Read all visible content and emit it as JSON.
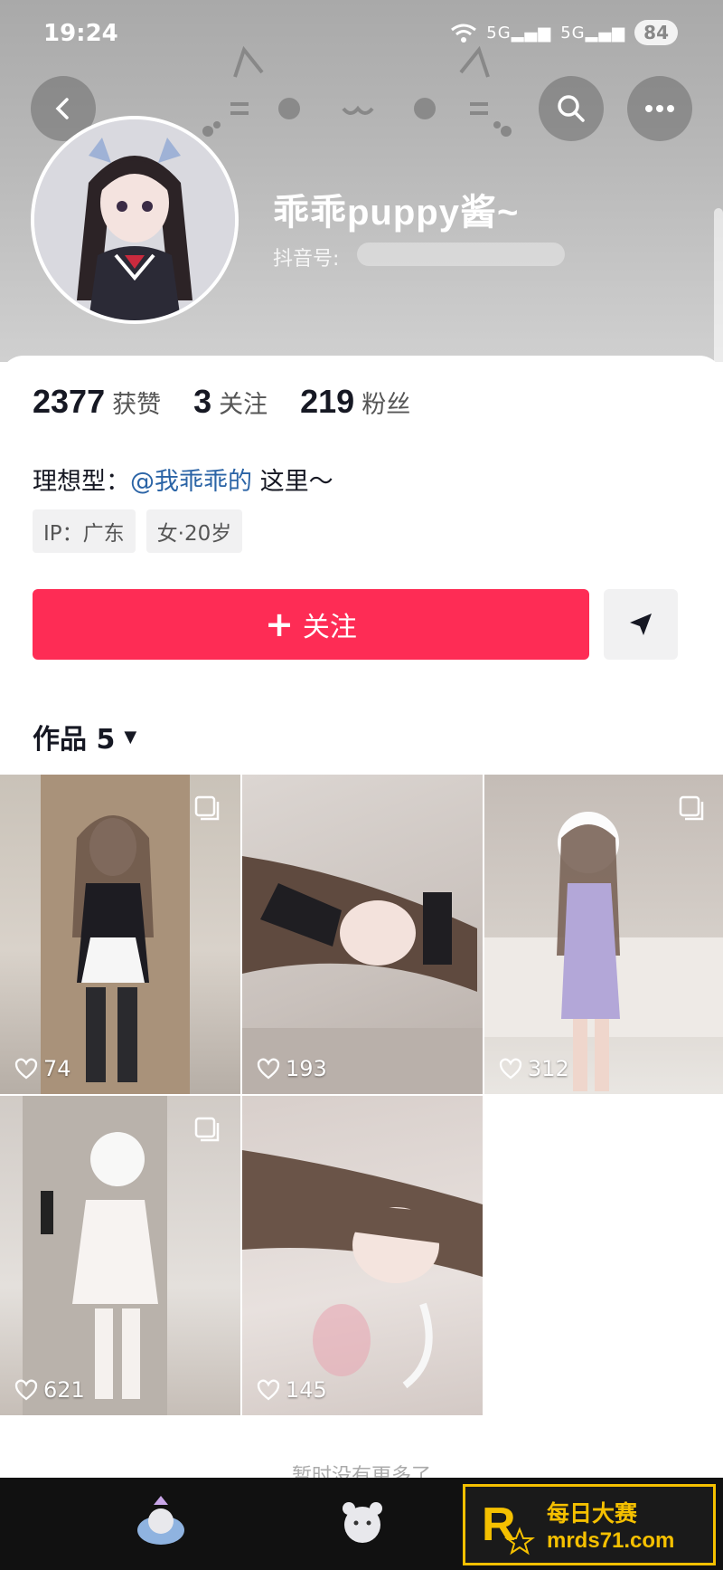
{
  "status_bar": {
    "time": "19:24",
    "signal_a": "5G",
    "signal_b": "5G",
    "battery": "84"
  },
  "profile": {
    "name": "乖乖puppy酱~",
    "douyin_id_label": "抖音号:",
    "stats": [
      {
        "value": "2377",
        "label": "获赞"
      },
      {
        "value": "3",
        "label": "关注"
      },
      {
        "value": "219",
        "label": "粉丝"
      }
    ],
    "bio_prefix": "理想型：",
    "bio_mention": "@我乖乖的",
    "bio_suffix": " 这里～",
    "tags": [
      "IP：广东",
      "女·20岁"
    ]
  },
  "actions": {
    "follow_plus": "+",
    "follow_label": "关注"
  },
  "works": {
    "tab_label": "作品 5",
    "caret": "▼"
  },
  "videos": [
    {
      "likes": "74",
      "multi": true
    },
    {
      "likes": "193",
      "multi": false
    },
    {
      "likes": "312",
      "multi": true
    },
    {
      "likes": "621",
      "multi": true
    },
    {
      "likes": "145",
      "multi": false
    }
  ],
  "footer_text": "暂时没有更多了",
  "watermark": {
    "title": "每日大赛",
    "url": "mrds71.com"
  },
  "colors": {
    "accent": "#fe2c55",
    "mention": "#2b64a6",
    "watermark": "#f5c000"
  }
}
